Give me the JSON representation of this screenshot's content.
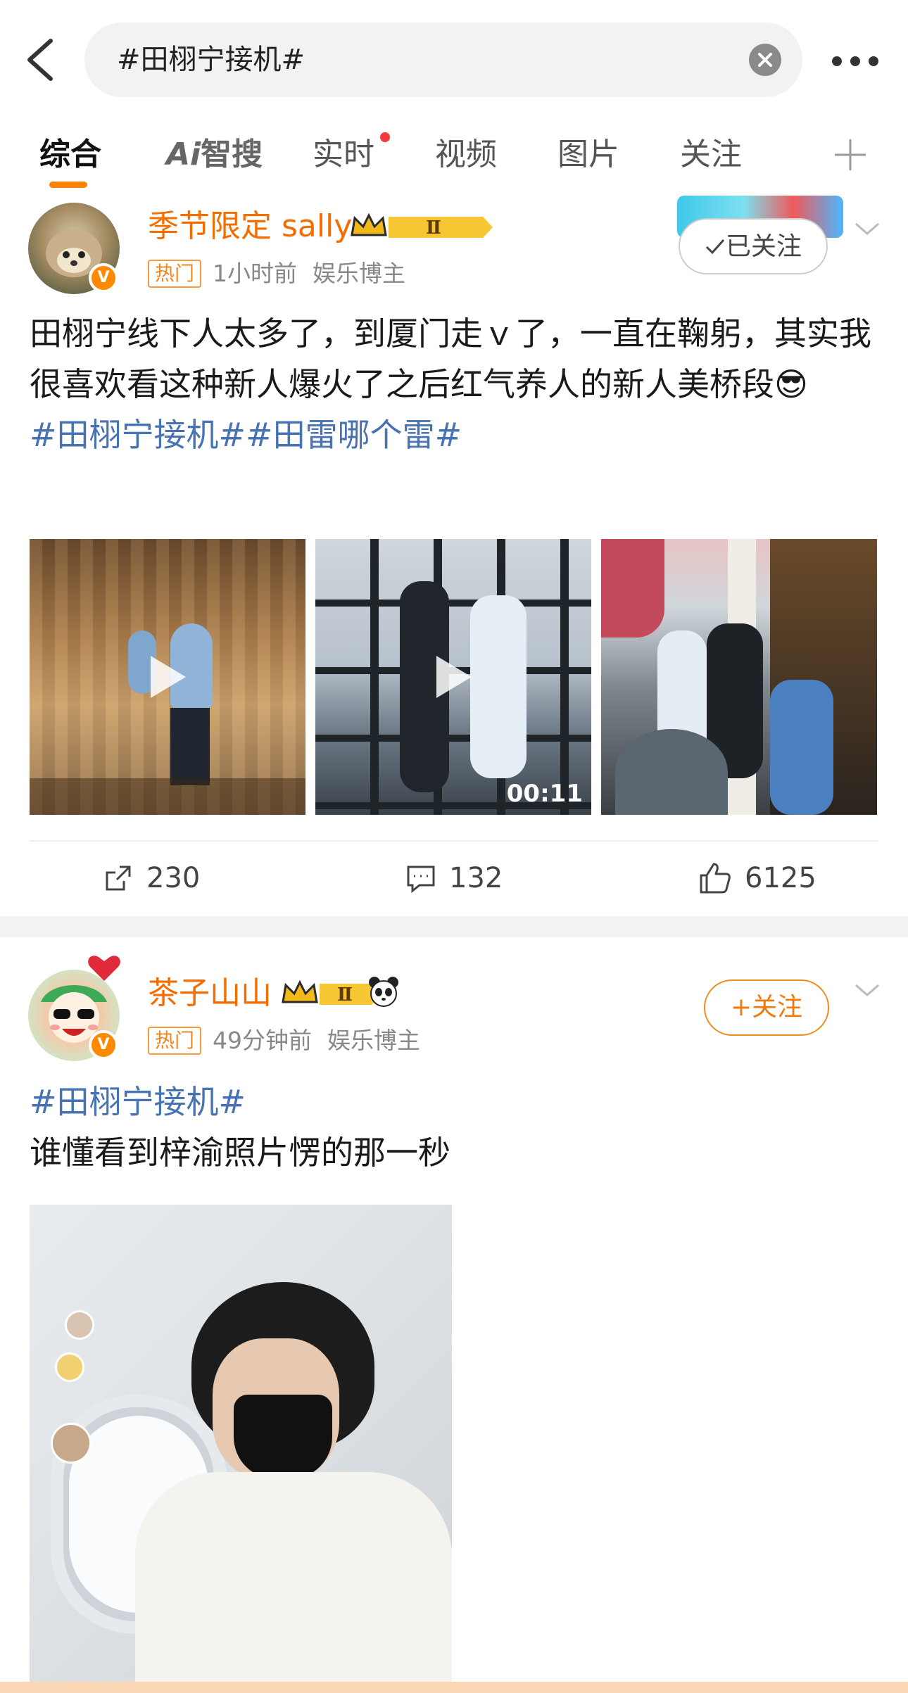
{
  "search": {
    "query": "#田栩宁接机#"
  },
  "tabs": [
    {
      "label": "综合"
    },
    {
      "label": "智搜",
      "prefix": "Ai"
    },
    {
      "label": "实时"
    },
    {
      "label": "视频"
    },
    {
      "label": "图片"
    },
    {
      "label": "关注"
    }
  ],
  "posts": [
    {
      "username": "季节限定 sally",
      "badge_level": "Ⅱ",
      "hot_tag": "热门",
      "time": "1小时前",
      "category": "娱乐博主",
      "follow_label": "已关注",
      "text": "田栩宁线下人太多了，到厦门走ｖ了，一直在鞠躬，其实我很喜欢看这种新人爆火了之后红气养人的新人美桥段😎",
      "hashtags": "#田栩宁接机##田雷哪个雷#",
      "video_duration": "00:11",
      "reposts": "230",
      "comments": "132",
      "likes": "6125"
    },
    {
      "username": "茶子山山",
      "badge_level": "Ⅱ",
      "hot_tag": "热门",
      "time": "49分钟前",
      "category": "娱乐博主",
      "follow_label": "+关注",
      "hashtags": "#田栩宁接机#",
      "text": "谁懂看到梓渝照片愣的那一秒"
    }
  ],
  "colors": {
    "accent": "#ff8200",
    "hashtag": "#4873b3",
    "username": "#f36d00"
  }
}
